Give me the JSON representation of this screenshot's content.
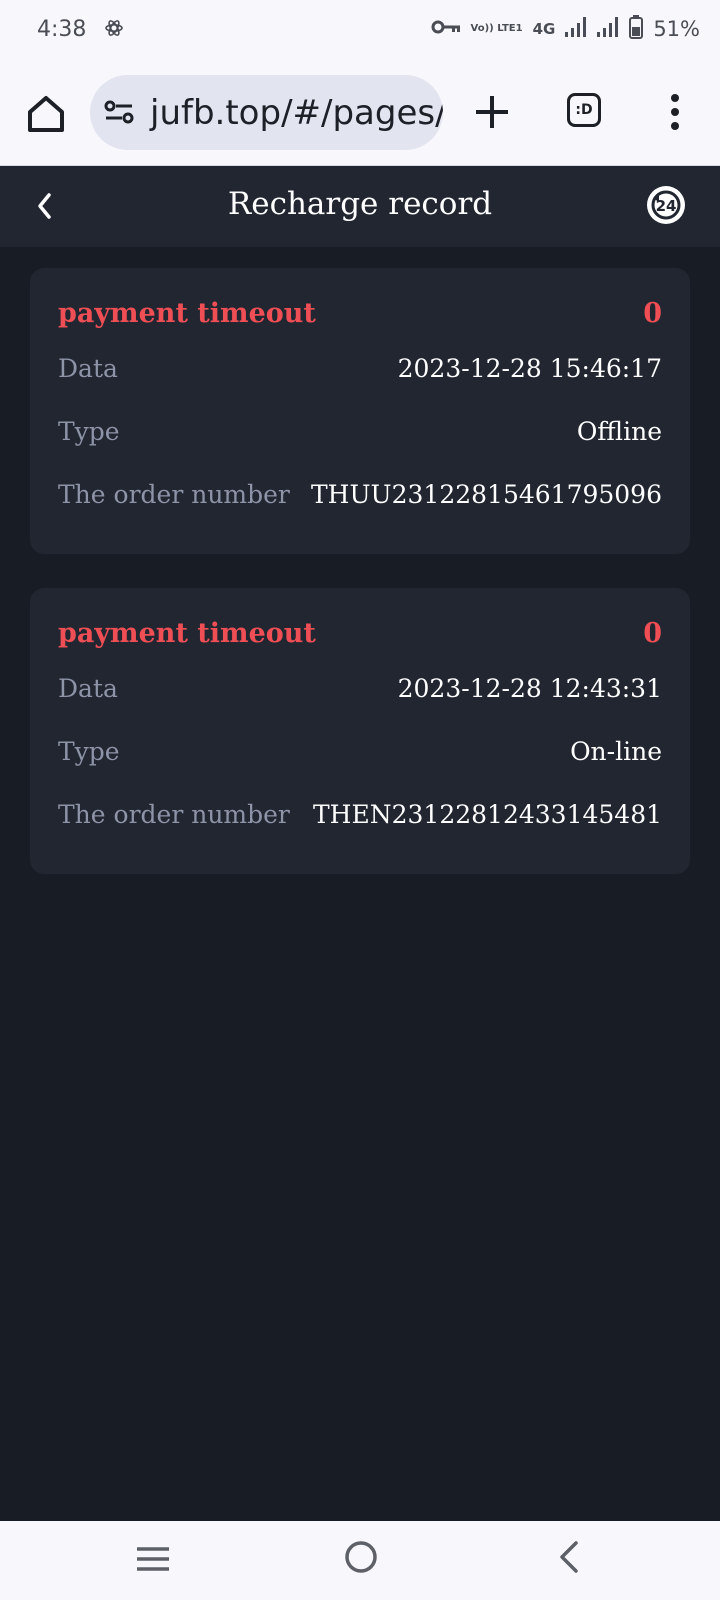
{
  "status_bar": {
    "time": "4:38",
    "volte": "Vo)) LTE1",
    "network": "4G",
    "battery": "51%",
    "icons": [
      "atom-icon",
      "key-icon",
      "volte-icon",
      "signal-icon",
      "signal-icon",
      "battery-icon"
    ]
  },
  "browser": {
    "url": "jufb.top/#/pages/",
    "tabs_label": ":D",
    "icons": [
      "home-icon",
      "tune-icon",
      "plus-icon",
      "tabs-icon",
      "more-vert-icon"
    ]
  },
  "header": {
    "title": "Recharge record",
    "icons": [
      "chevron-left-icon",
      "support-24-icon"
    ]
  },
  "records": [
    {
      "status": "payment timeout",
      "amount": "0",
      "date_label": "Data",
      "date_value": "2023-12-28 15:46:17",
      "type_label": "Type",
      "type_value": "Offline",
      "order_label": "The order number",
      "order_value": "THUU23122815461795096"
    },
    {
      "status": "payment timeout",
      "amount": "0",
      "date_label": "Data",
      "date_value": "2023-12-28 12:43:31",
      "type_label": "Type",
      "type_value": "On-line",
      "order_label": "The order number",
      "order_value": "THEN23122812433145481"
    }
  ],
  "colors": {
    "page_bg": "#181d25",
    "card_bg": "#212631",
    "status_red": "#ee4e54",
    "label_gray": "#8e94a8"
  }
}
